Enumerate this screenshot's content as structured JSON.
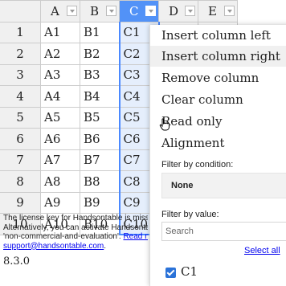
{
  "columns": [
    "A",
    "B",
    "C",
    "D",
    "E"
  ],
  "rows": [
    {
      "n": "1",
      "a": "A1",
      "b": "B1",
      "c": "C1"
    },
    {
      "n": "2",
      "a": "A2",
      "b": "B2",
      "c": "C2"
    },
    {
      "n": "3",
      "a": "A3",
      "b": "B3",
      "c": "C3"
    },
    {
      "n": "4",
      "a": "A4",
      "b": "B4",
      "c": "C4"
    },
    {
      "n": "5",
      "a": "A5",
      "b": "B5",
      "c": "C5"
    },
    {
      "n": "6",
      "a": "A6",
      "b": "B6",
      "c": "C6"
    },
    {
      "n": "7",
      "a": "A7",
      "b": "B7",
      "c": "C7"
    },
    {
      "n": "8",
      "a": "A8",
      "b": "B8",
      "c": "C8"
    },
    {
      "n": "9",
      "a": "A9",
      "b": "B9",
      "c": "C9"
    },
    {
      "n": "10",
      "a": "A10",
      "b": "B10",
      "c": "C10"
    }
  ],
  "license": {
    "line1": "The license key for Handsontable is miss",
    "line2": "Alternatively, you can activate Handsonta",
    "line3_text": "'non-commercial-and-evaluation'. ",
    "line3_link": "Read n",
    "email": "support@handsontable.com",
    "email_suffix": "."
  },
  "version": "8.3.0",
  "menu": {
    "items": [
      "Insert column left",
      "Insert column right",
      "Remove column",
      "Clear column",
      "Read only",
      "Alignment"
    ],
    "filter_condition_label": "Filter by condition:",
    "condition_value": "None",
    "filter_value_label": "Filter by value:",
    "search_placeholder": "Search",
    "select_all": "Select all",
    "checkbox_label": "C1"
  },
  "colors": {
    "selected_header": "#5292f7",
    "selected_cells": "#e5eefc",
    "link": "#0000ee"
  },
  "icons": {
    "cursor": "hand-pointer-icon",
    "dropdown": "chevron-down-icon",
    "checkbox": "checkbox-checked-icon"
  }
}
